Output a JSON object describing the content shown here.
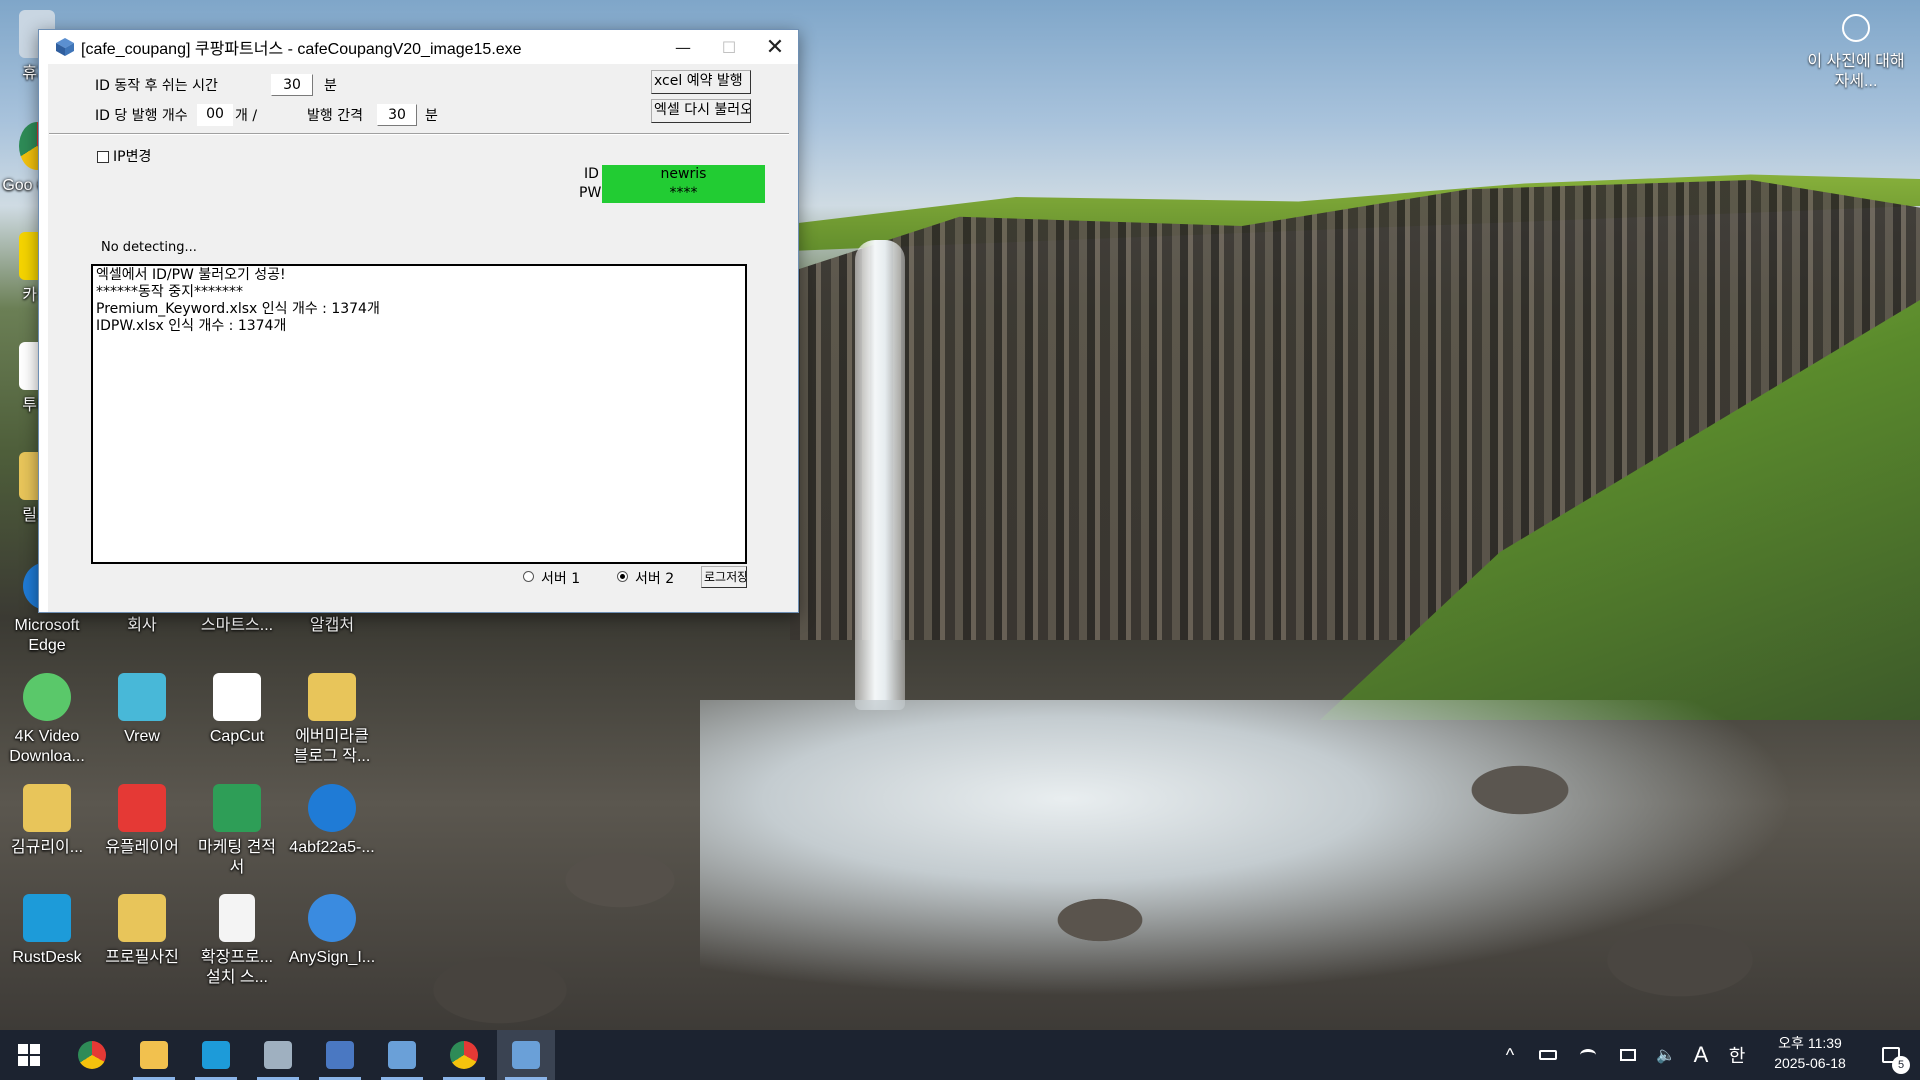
{
  "desktop": {
    "icons": [
      {
        "label": "휴지",
        "color": "#c9d6e2"
      },
      {
        "label": "Goo Chro",
        "color": "#2e8b57"
      },
      {
        "label": "카카",
        "color": "#f5d400"
      },
      {
        "label": "투데",
        "color": "#ffffff"
      },
      {
        "label": "릴스",
        "color": "#e8c55a"
      },
      {
        "label": "Microsoft Edge",
        "color": "#1f7bd6"
      },
      {
        "label": "회사",
        "color": "#e8c55a"
      },
      {
        "label": "스마트스...",
        "color": "#e8c55a"
      },
      {
        "label": "알캡처",
        "color": "#3aa3e8"
      },
      {
        "label": "4K Video Downloa...",
        "color": "#5ac86a"
      },
      {
        "label": "Vrew",
        "color": "#48b8d8"
      },
      {
        "label": "CapCut",
        "color": "#ffffff"
      },
      {
        "label": "에버미라클 블로그 작...",
        "color": "#e8c55a"
      },
      {
        "label": "김규리이...",
        "color": "#e8c55a"
      },
      {
        "label": "유플레이어",
        "color": "#e53935"
      },
      {
        "label": "마케팅 견적서",
        "color": "#2e9e57"
      },
      {
        "label": "4abf22a5-...",
        "color": "#1f7bd6"
      },
      {
        "label": "RustDesk",
        "color": "#1d9bd9"
      },
      {
        "label": "프로필사진",
        "color": "#e8c55a"
      },
      {
        "label": "확장프로... 설치 스...",
        "color": "#f4f4f4"
      },
      {
        "label": "AnySign_I...",
        "color": "#3a8be0"
      }
    ]
  },
  "window": {
    "title": "[cafe_coupang] 쿠팡파트너스 - cafeCoupangV20_image15.exe",
    "min_icon": "minimize-icon",
    "max_icon": "maximize-icon",
    "close_icon": "close-icon",
    "rest_time_label": "ID 동작 후 쉬는 시간",
    "rest_time_value": "30",
    "rest_time_unit": "분",
    "per_id_label": "ID 당 발행 개수",
    "per_id_value": "00",
    "per_id_unit": "개 /",
    "interval_label": "발행 간격",
    "interval_value": "30",
    "interval_unit": "분",
    "excel_reserve_button": "xcel 예약 발행",
    "excel_reload_button": "엑셀 다시 불러오기",
    "ip_change_label": "IP변경",
    "ip_change_checked": false,
    "id_label": "ID",
    "id_value": "newris",
    "pw_label": "PW",
    "pw_value": "****",
    "status_text": "No detecting...",
    "log_lines": "엑셀에서 ID/PW 불러오기 성공!\n******동작 중지*******\nPremium_Keyword.xlsx 인식 개수 : 1374개\nIDPW.xlsx 인식 개수 : 1374개",
    "server1_label": "서버 1",
    "server2_label": "서버 2",
    "selected_server": "서버 2",
    "log_save_button": "로그저장"
  },
  "wallpaper_info": {
    "text": "이 사진에 대해 자세..."
  },
  "taskbar": {
    "apps": [
      {
        "name": "start-button",
        "color": "#ffffff"
      },
      {
        "name": "chrome",
        "color": "#e53935"
      },
      {
        "name": "file-explorer",
        "color": "#f2c14e"
      },
      {
        "name": "rustdesk",
        "color": "#1d9bd9"
      },
      {
        "name": "app-window",
        "color": "#9fb0c0"
      },
      {
        "name": "remote-desktop",
        "color": "#4a78c2"
      },
      {
        "name": "app-cube",
        "color": "#6aa0d8"
      },
      {
        "name": "chrome-2",
        "color": "#e53935"
      },
      {
        "name": "cafe-coupang",
        "color": "#6aa0d8"
      }
    ],
    "tray": {
      "chevron": "^",
      "ime_mode": "A",
      "ime_lang": "한",
      "time": "오후 11:39",
      "date": "2025-06-18",
      "notification_count": "5"
    }
  }
}
